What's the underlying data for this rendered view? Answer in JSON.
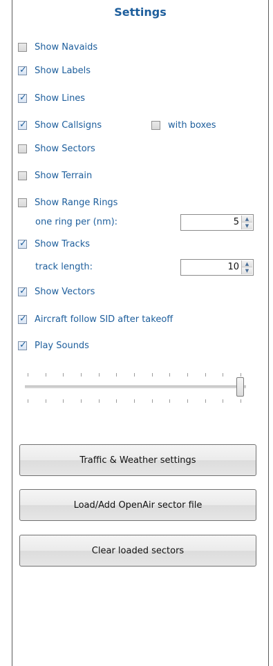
{
  "panel": {
    "title": "Settings"
  },
  "options": [
    {
      "id": "navaids",
      "label": "Show Navaids",
      "checked": false
    },
    {
      "id": "labels",
      "label": "Show Labels",
      "checked": true
    },
    {
      "id": "lines",
      "label": "Show Lines",
      "checked": true
    },
    {
      "id": "callsigns",
      "label": "Show Callsigns",
      "checked": true
    },
    {
      "id": "sectors",
      "label": "Show Sectors",
      "checked": false
    },
    {
      "id": "terrain",
      "label": "Show Terrain",
      "checked": false
    },
    {
      "id": "rings",
      "label": "Show Range Rings",
      "checked": false
    },
    {
      "id": "tracks",
      "label": "Show Tracks",
      "checked": true
    },
    {
      "id": "vectors",
      "label": "Show Vectors",
      "checked": true
    },
    {
      "id": "sid",
      "label": "Aircraft follow SID after takeoff",
      "checked": true
    },
    {
      "id": "sounds",
      "label": "Play Sounds",
      "checked": true
    }
  ],
  "with_boxes": {
    "label": "with boxes",
    "checked": false
  },
  "ring_spacing": {
    "label": "one ring per (nm):",
    "value": "5"
  },
  "track_length": {
    "label": "track length:",
    "value": "10"
  },
  "volume_slider": {
    "level": 1.0
  },
  "buttons": {
    "traffic": "Traffic & Weather settings",
    "load_sector": "Load/Add OpenAir sector file",
    "clear_sectors": "Clear loaded sectors"
  },
  "colors": {
    "accent": "#1d5e9c"
  },
  "icons": {
    "check": "checkmark-icon",
    "spin_up": "arrow-up-icon",
    "spin_down": "arrow-down-icon"
  }
}
